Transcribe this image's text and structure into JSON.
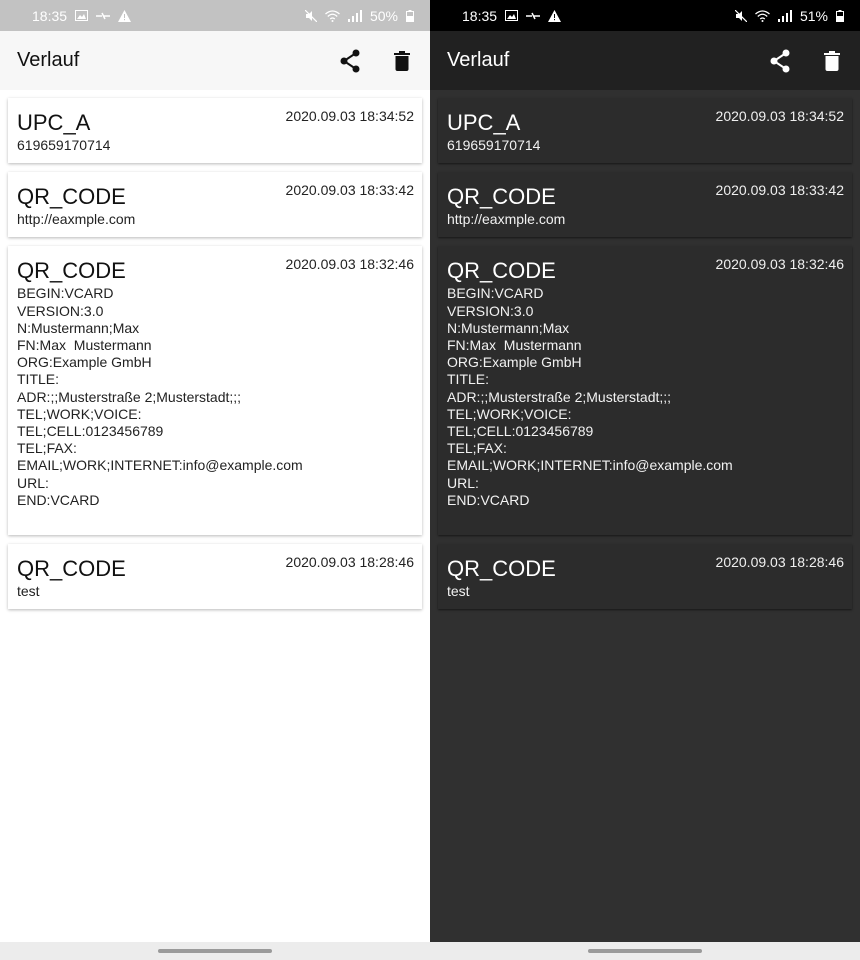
{
  "light": {
    "status": {
      "time": "18:35",
      "battery": "50%"
    },
    "title": "Verlauf",
    "entries": [
      {
        "type": "UPC_A",
        "date": "2020.09.03 18:34:52",
        "content": "619659170714"
      },
      {
        "type": "QR_CODE",
        "date": "2020.09.03 18:33:42",
        "content": "http://eaxmple.com"
      },
      {
        "type": "QR_CODE",
        "date": "2020.09.03 18:32:46",
        "content": "BEGIN:VCARD\nVERSION:3.0\nN:Mustermann;Max\nFN:Max  Mustermann\nORG:Example GmbH\nTITLE:\nADR:;;Musterstraße 2;Musterstadt;;;\nTEL;WORK;VOICE:\nTEL;CELL:0123456789\nTEL;FAX:\nEMAIL;WORK;INTERNET:info@example.com\nURL:\nEND:VCARD"
      },
      {
        "type": "QR_CODE",
        "date": "2020.09.03 18:28:46",
        "content": "test"
      }
    ]
  },
  "dark": {
    "status": {
      "time": "18:35",
      "battery": "51%"
    },
    "title": "Verlauf",
    "entries": [
      {
        "type": "UPC_A",
        "date": "2020.09.03 18:34:52",
        "content": "619659170714"
      },
      {
        "type": "QR_CODE",
        "date": "2020.09.03 18:33:42",
        "content": "http://eaxmple.com"
      },
      {
        "type": "QR_CODE",
        "date": "2020.09.03 18:32:46",
        "content": "BEGIN:VCARD\nVERSION:3.0\nN:Mustermann;Max\nFN:Max  Mustermann\nORG:Example GmbH\nTITLE:\nADR:;;Musterstraße 2;Musterstadt;;;\nTEL;WORK;VOICE:\nTEL;CELL:0123456789\nTEL;FAX:\nEMAIL;WORK;INTERNET:info@example.com\nURL:\nEND:VCARD"
      },
      {
        "type": "QR_CODE",
        "date": "2020.09.03 18:28:46",
        "content": "test"
      }
    ]
  },
  "icons": {
    "status_left": [
      "image-icon",
      "wifi-direct-icon",
      "warning-icon"
    ],
    "status_right": [
      "mute-icon",
      "wifi-icon",
      "signal-icon",
      "battery-icon"
    ],
    "actions": [
      "share-icon",
      "delete-icon"
    ]
  },
  "colors": {
    "light_background": "#ffffff",
    "light_appbar": "#f7f7f7",
    "dark_background": "#303030",
    "dark_appbar": "#212121"
  }
}
